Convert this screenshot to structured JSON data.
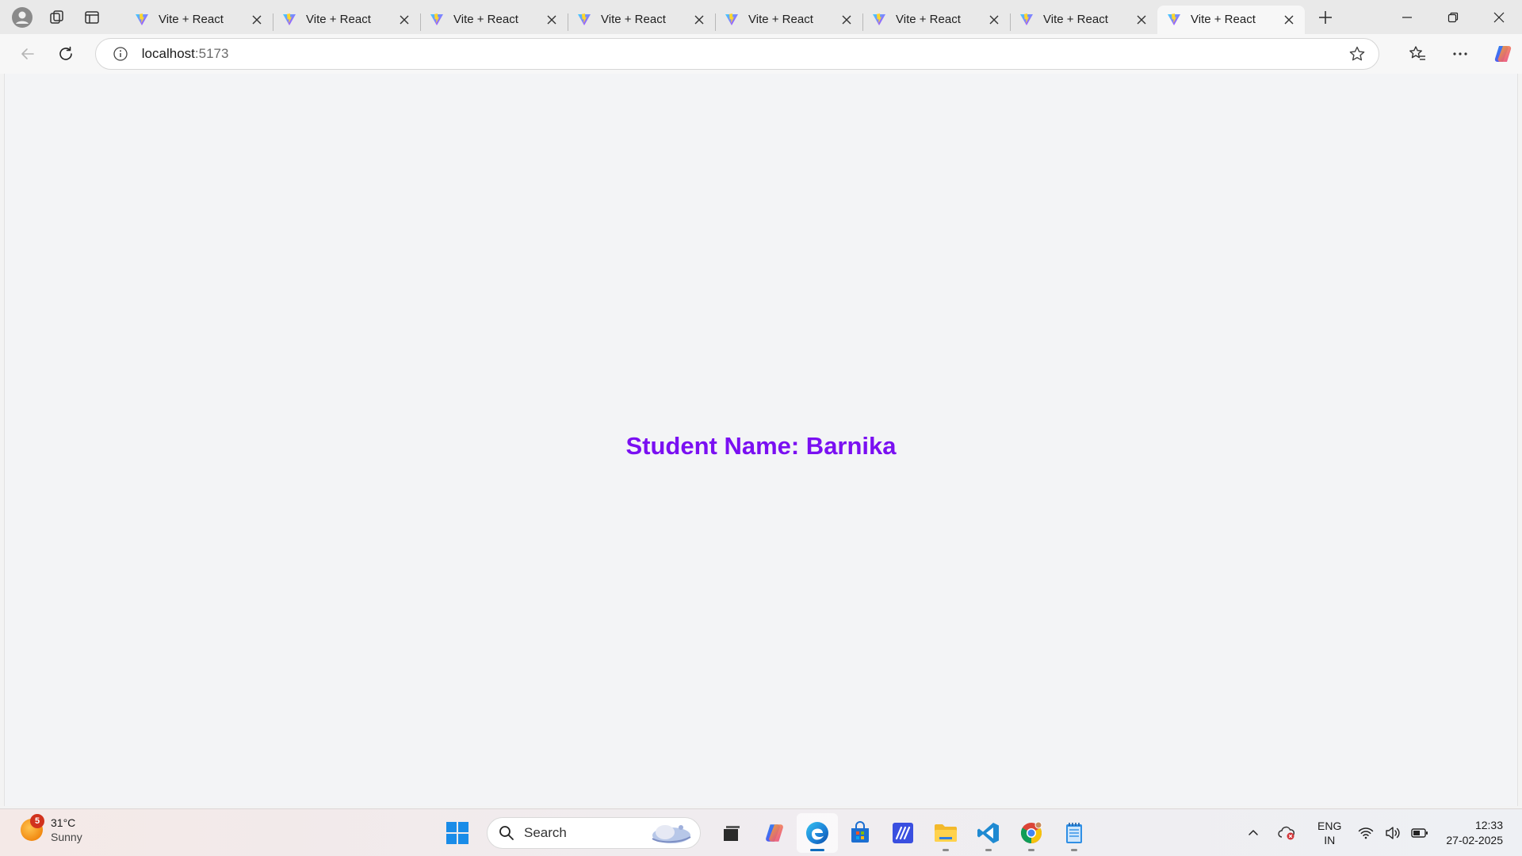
{
  "browser": {
    "tabs": [
      {
        "title": "Vite + React",
        "active": false
      },
      {
        "title": "Vite + React",
        "active": false
      },
      {
        "title": "Vite + React",
        "active": false
      },
      {
        "title": "Vite + React",
        "active": false
      },
      {
        "title": "Vite + React",
        "active": false
      },
      {
        "title": "Vite + React",
        "active": false
      },
      {
        "title": "Vite + React",
        "active": false
      },
      {
        "title": "Vite + React",
        "active": true
      }
    ],
    "address": {
      "host": "localhost",
      "port": ":5173"
    }
  },
  "page": {
    "student_text": "Student Name: Barnika",
    "text_color": "#7a0ff2"
  },
  "taskbar": {
    "weather": {
      "temp": "31°C",
      "condition": "Sunny",
      "badge": "5"
    },
    "search_label": "Search",
    "apps": [
      "task-view",
      "copilot",
      "edge",
      "store",
      "code-app",
      "file-explorer",
      "vscode",
      "chrome",
      "notepad"
    ],
    "language": {
      "line1": "ENG",
      "line2": "IN"
    },
    "clock": {
      "time": "12:33",
      "date": "27-02-2025"
    }
  }
}
